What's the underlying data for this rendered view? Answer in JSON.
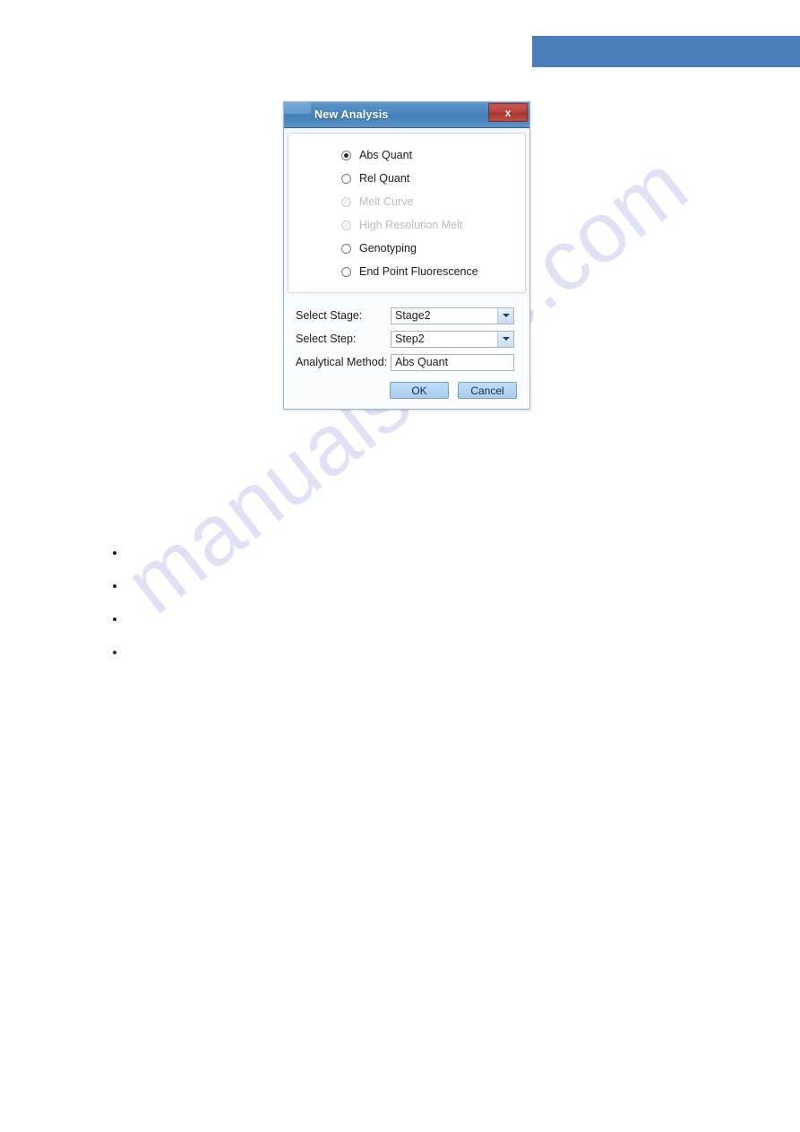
{
  "dialog": {
    "title": "New Analysis",
    "close_label": "x",
    "analysis_options": [
      {
        "label": "Abs Quant",
        "selected": true,
        "disabled": false
      },
      {
        "label": "Rel Quant",
        "selected": false,
        "disabled": false
      },
      {
        "label": "Melt Curve",
        "selected": false,
        "disabled": true
      },
      {
        "label": "High Resolution Melt",
        "selected": false,
        "disabled": true
      },
      {
        "label": "Genotyping",
        "selected": false,
        "disabled": false
      },
      {
        "label": "End Point Fluorescence",
        "selected": false,
        "disabled": false
      }
    ],
    "fields": [
      {
        "label": "Select Stage:",
        "value": "Stage2",
        "type": "dropdown"
      },
      {
        "label": "Select Step:",
        "value": "Step2",
        "type": "dropdown"
      },
      {
        "label": "Analytical Method:",
        "value": "Abs Quant",
        "type": "text"
      }
    ],
    "ok_label": "OK",
    "cancel_label": "Cancel"
  },
  "page": {
    "watermark": "manualshive.com",
    "bullets": [
      "",
      "",
      "",
      ""
    ],
    "banner_color": "#4a7eba"
  }
}
